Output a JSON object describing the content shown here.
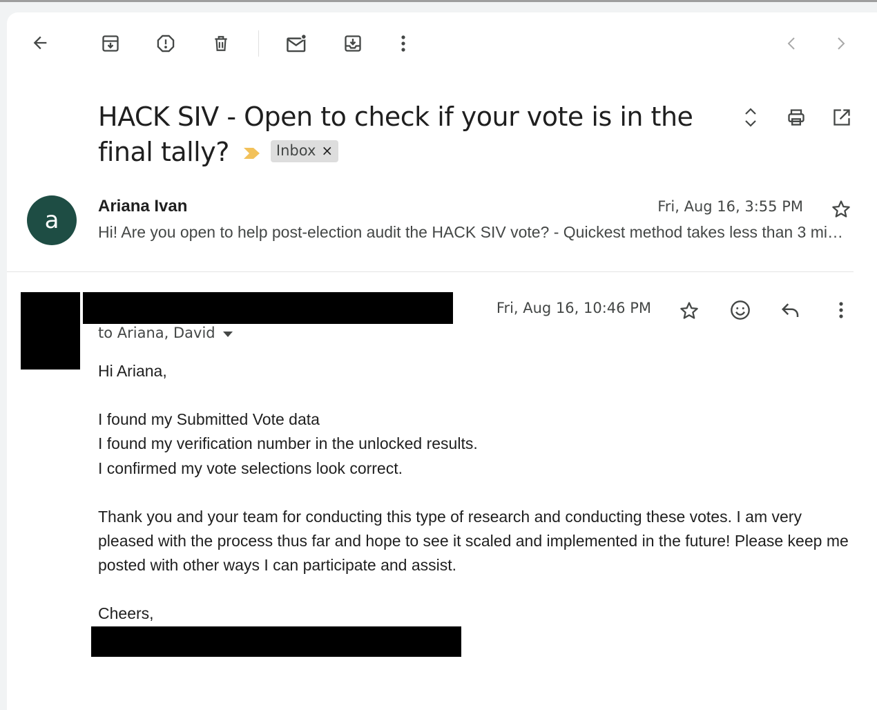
{
  "toolbar": {
    "back": "back-arrow-icon",
    "archive": "archive-icon",
    "report_spam": "report-spam-icon",
    "delete": "trash-icon",
    "mark_unread": "mark-unread-icon",
    "move_to": "move-to-inbox-icon",
    "more": "more-vert-icon",
    "older": "chevron-left-icon",
    "newer": "chevron-right-icon"
  },
  "thread": {
    "subject": "HACK SIV - Open to check if your vote is in the final tally?",
    "label_chip": "Inbox",
    "label_remove": "×",
    "important_color": "#f2c15a"
  },
  "message1": {
    "avatar_letter": "a",
    "avatar_color": "#1e4d44",
    "sender": "Ariana Ivan",
    "date": "Fri, Aug 16, 3:55 PM",
    "snippet": "Hi! Are you open to help post-election audit the HACK SIV vote? - Quickest method takes less than 3 minutes..."
  },
  "message2": {
    "date": "Fri, Aug 16, 10:46 PM",
    "recipients": "to Ariana, David",
    "body": {
      "greeting": "Hi Ariana,",
      "line1": "I found my Submitted Vote data",
      "line2": "I found my verification number in the unlocked results.",
      "line3": "I confirmed my vote selections look correct.",
      "paragraph": "Thank you and your team for conducting this type of research and conducting these votes. I am very pleased with the process thus far and hope to see it scaled and implemented in the future! Please keep me posted with other ways I can participate and assist.",
      "signoff": "Cheers,"
    }
  }
}
